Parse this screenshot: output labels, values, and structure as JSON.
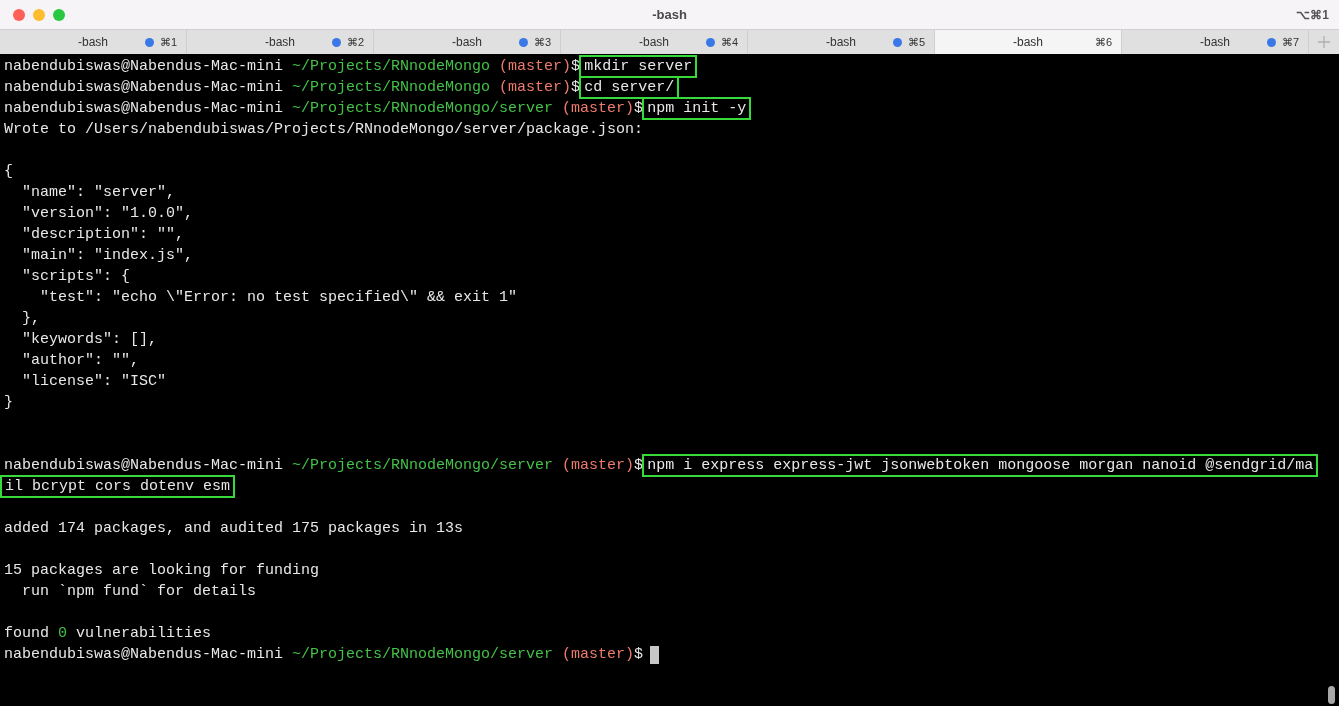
{
  "window": {
    "title": "-bash",
    "shortcut": "⌥⌘1"
  },
  "tabs": [
    {
      "label": "-bash",
      "shortcut": "⌘1",
      "activity": true,
      "selected": false
    },
    {
      "label": "-bash",
      "shortcut": "⌘2",
      "activity": true,
      "selected": false
    },
    {
      "label": "-bash",
      "shortcut": "⌘3",
      "activity": true,
      "selected": false
    },
    {
      "label": "-bash",
      "shortcut": "⌘4",
      "activity": true,
      "selected": false
    },
    {
      "label": "-bash",
      "shortcut": "⌘5",
      "activity": true,
      "selected": false
    },
    {
      "label": "-bash",
      "shortcut": "⌘6",
      "activity": false,
      "selected": true
    },
    {
      "label": "-bash",
      "shortcut": "⌘7",
      "activity": true,
      "selected": false
    }
  ],
  "terminal": {
    "lines": [
      {
        "kind": "prompt",
        "user": "nabendubiswas@Nabendus-Mac-mini",
        "path": "~/Projects/RNnodeMongo",
        "branch": "(master)",
        "symbol": "$",
        "command": "mkdir server",
        "highlighted": true
      },
      {
        "kind": "prompt",
        "user": "nabendubiswas@Nabendus-Mac-mini",
        "path": "~/Projects/RNnodeMongo",
        "branch": "(master)",
        "symbol": "$",
        "command": "cd server/",
        "highlighted": true
      },
      {
        "kind": "prompt",
        "user": "nabendubiswas@Nabendus-Mac-mini",
        "path": "~/Projects/RNnodeMongo/server",
        "branch": "(master)",
        "symbol": "$",
        "command": "npm init -y",
        "highlighted": true
      },
      {
        "kind": "output",
        "text": "Wrote to /Users/nabendubiswas/Projects/RNnodeMongo/server/package.json:"
      },
      {
        "kind": "blank"
      },
      {
        "kind": "output",
        "text": "{"
      },
      {
        "kind": "output",
        "text": "  \"name\": \"server\","
      },
      {
        "kind": "output",
        "text": "  \"version\": \"1.0.0\","
      },
      {
        "kind": "output",
        "text": "  \"description\": \"\","
      },
      {
        "kind": "output",
        "text": "  \"main\": \"index.js\","
      },
      {
        "kind": "output",
        "text": "  \"scripts\": {"
      },
      {
        "kind": "output",
        "text": "    \"test\": \"echo \\\"Error: no test specified\\\" && exit 1\""
      },
      {
        "kind": "output",
        "text": "  },"
      },
      {
        "kind": "output",
        "text": "  \"keywords\": [],"
      },
      {
        "kind": "output",
        "text": "  \"author\": \"\","
      },
      {
        "kind": "output",
        "text": "  \"license\": \"ISC\""
      },
      {
        "kind": "output",
        "text": "}"
      },
      {
        "kind": "blank"
      },
      {
        "kind": "blank"
      },
      {
        "kind": "prompt",
        "user": "nabendubiswas@Nabendus-Mac-mini",
        "path": "~/Projects/RNnodeMongo/server",
        "branch": "(master)",
        "symbol": "$",
        "command": "npm i express express-jwt jsonwebtoken mongoose morgan nanoid @sendgrid/ma",
        "highlighted": true
      },
      {
        "kind": "continuation",
        "text": "il bcrypt cors dotenv esm",
        "highlighted": true
      },
      {
        "kind": "blank"
      },
      {
        "kind": "output",
        "text": "added 174 packages, and audited 175 packages in 13s"
      },
      {
        "kind": "blank"
      },
      {
        "kind": "output",
        "text": "15 packages are looking for funding"
      },
      {
        "kind": "output",
        "text": "  run `npm fund` for details"
      },
      {
        "kind": "blank"
      },
      {
        "kind": "summary",
        "prefix": "found",
        "count": "0",
        "suffix": "vulnerabilities"
      },
      {
        "kind": "prompt",
        "user": "nabendubiswas@Nabendus-Mac-mini",
        "path": "~/Projects/RNnodeMongo/server",
        "branch": "(master)",
        "symbol": "$",
        "cursor": true
      }
    ]
  }
}
